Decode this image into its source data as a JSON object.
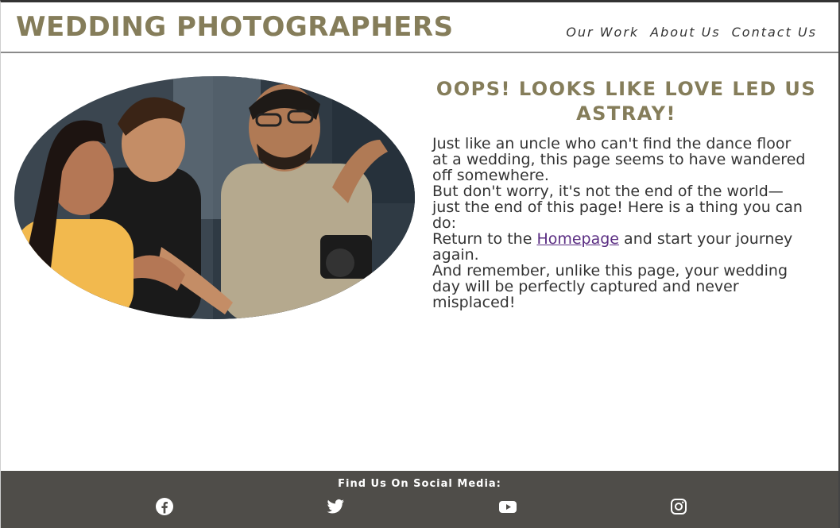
{
  "header": {
    "logo": "WEDDING PHOTOGRAPHERS",
    "nav": [
      {
        "label": "Our Work"
      },
      {
        "label": "About Us"
      },
      {
        "label": "Contact Us"
      }
    ]
  },
  "main": {
    "heading": "OOPS! LOOKS LIKE LOVE LED US ASTRAY!",
    "paragraph1": "Just like an uncle who can't find the dance floor at a wedding, this page seems to have wandered off somewhere.",
    "paragraph2": "But don't worry, it's not the end of the world—just the end of this page! Here is a thing you can do:",
    "paragraph3_before": "Return to the ",
    "homepage_link": "Homepage",
    "paragraph3_after": " and start your journey again.",
    "paragraph4": "And remember, unlike this page, your wedding day will be perfectly captured and never misplaced!"
  },
  "footer": {
    "title": "Find Us On Social Media:",
    "icons": [
      "facebook-icon",
      "twitter-icon",
      "youtube-icon",
      "instagram-icon"
    ]
  },
  "colors": {
    "brand": "#857d5a",
    "text": "#333333",
    "link": "#5a2d82",
    "footer_bg": "#4f4d49"
  }
}
